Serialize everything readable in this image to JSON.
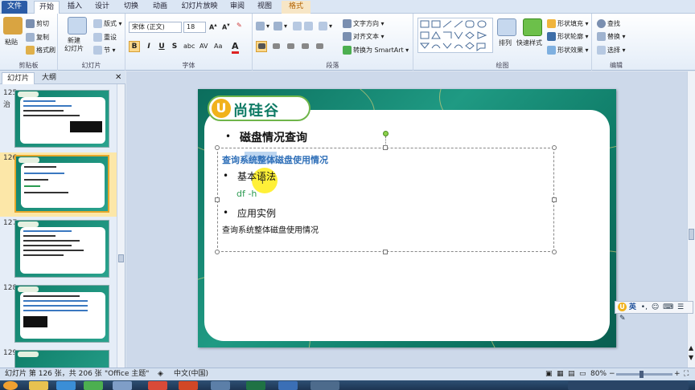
{
  "tabs": [
    "文件",
    "开始",
    "插入",
    "设计",
    "切换",
    "动画",
    "幻灯片放映",
    "审阅",
    "视图",
    "格式"
  ],
  "ribbon": {
    "clipboard": {
      "label": "剪贴板",
      "paste": "粘贴",
      "cut": "剪切",
      "copy": "复制",
      "format_painter": "格式刷"
    },
    "slides": {
      "label": "幻灯片",
      "new_slide": "新建\n幻灯片",
      "layout": "版式",
      "reset": "重设",
      "section": "节"
    },
    "font": {
      "label": "字体",
      "font_name": "宋体 (正文)",
      "font_size": "18",
      "bold": "B",
      "italic": "I",
      "underline": "U",
      "strike": "S",
      "shadow": "abc",
      "spacing": "AV",
      "case": "Aa",
      "color": "A"
    },
    "paragraph": {
      "label": "段落",
      "text_direction": "文字方向",
      "align_text": "对齐文本",
      "smartart": "转换为 SmartArt"
    },
    "drawing": {
      "label": "绘图",
      "arrange": "排列",
      "quick_styles": "快速样式",
      "shape_fill": "形状填充",
      "shape_outline": "形状轮廓",
      "shape_effects": "形状效果"
    },
    "editing": {
      "label": "编辑",
      "find": "查找",
      "replace": "替换",
      "select": "选择"
    }
  },
  "panel": {
    "tabs": [
      "幻灯片",
      "大纲"
    ],
    "thumbs": [
      {
        "num": "125",
        "extra": "治"
      },
      {
        "num": "126",
        "extra": ""
      },
      {
        "num": "127",
        "extra": ""
      },
      {
        "num": "128",
        "extra": ""
      },
      {
        "num": "129",
        "extra": ""
      }
    ]
  },
  "slide": {
    "logo_text": "尚硅谷",
    "logo_letter": "U",
    "title": "磁盘情况查询",
    "subhead": "查询系统整体磁盘使用情况",
    "bullet1": "基本语法",
    "command": "df -h",
    "bullet2": "应用实例",
    "description": "查询系统整体磁盘使用情况"
  },
  "ime": {
    "lang": "英"
  },
  "status": {
    "slide_info": "幻灯片 第 126 张，共 206 张",
    "theme": "\"Office 主题\"",
    "language": "中文(中国)",
    "zoom": "80%"
  },
  "colors": {
    "accent": "#2c5ca6",
    "teal": "#0e7a66",
    "highlight": "#fbd88b"
  }
}
